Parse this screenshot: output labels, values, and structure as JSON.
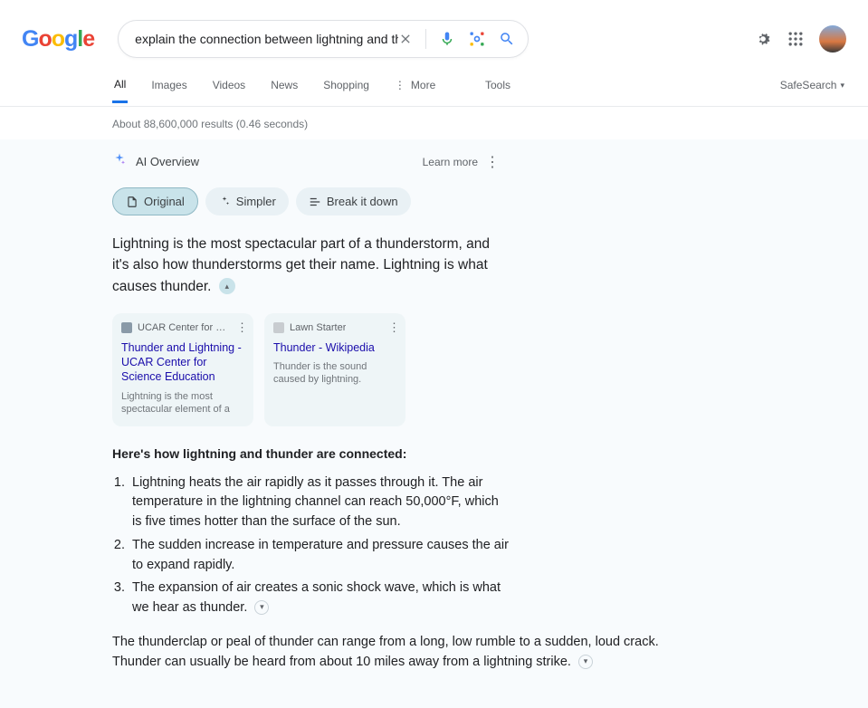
{
  "search": {
    "query": "explain the connection between lightning and thunder"
  },
  "tabs": {
    "all": "All",
    "images": "Images",
    "videos": "Videos",
    "news": "News",
    "shopping": "Shopping",
    "more": "More",
    "tools": "Tools",
    "safesearch": "SafeSearch"
  },
  "stats": "About 88,600,000 results (0.46 seconds)",
  "ai": {
    "title": "AI Overview",
    "learn_more": "Learn more",
    "chips": {
      "original": "Original",
      "simpler": "Simpler",
      "break": "Break it down"
    },
    "summary": "Lightning is the most spectacular part of a thunderstorm, and it's also how thunderstorms get their name. Lightning is what causes thunder.",
    "cards": [
      {
        "source": "UCAR Center for Science Edu...",
        "title": "Thunder and Lightning - UCAR Center for Science Education",
        "desc": "Lightning is the most spectacular element of a thunderstorm. In fact it i..."
      },
      {
        "source": "Lawn Starter",
        "title": "Thunder - Wikipedia",
        "desc": "Thunder is the sound caused by lightning. Depending upon the..."
      }
    ],
    "subhead": "Here's how lightning and thunder are connected:",
    "items": [
      "Lightning heats the air rapidly as it passes through it. The air temperature in the lightning channel can reach 50,000°F, which is five times hotter than the surface of the sun.",
      "The sudden increase in temperature and pressure causes the air to expand rapidly.",
      "The expansion of air creates a sonic shock wave, which is what we hear as thunder."
    ],
    "para": "The thunderclap or peal of thunder can range from a long, low rumble to a sudden, loud crack. Thunder can usually be heard from about 10 miles away from a lightning strike."
  }
}
